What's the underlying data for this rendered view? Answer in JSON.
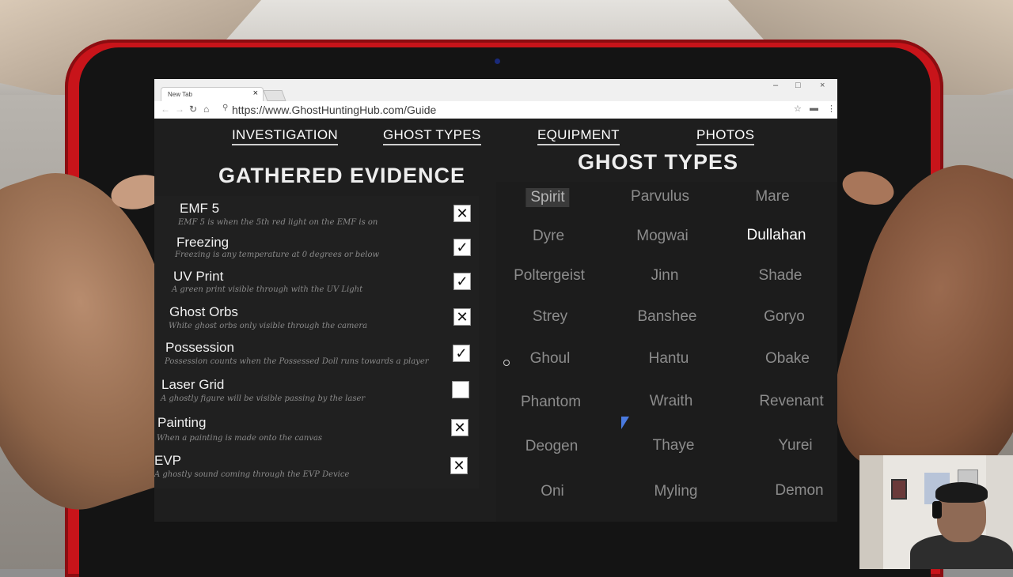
{
  "browser": {
    "tab_title": "New Tab",
    "tab_close": "×",
    "url": "https://www.GhostHuntingHub.com/Guide",
    "window_controls": [
      "–",
      "□",
      "×"
    ]
  },
  "nav_menu": [
    {
      "label": "INVESTIGATION"
    },
    {
      "label": "GHOST TYPES"
    },
    {
      "label": "EQUIPMENT"
    },
    {
      "label": "PHOTOS"
    }
  ],
  "evidence_section": {
    "title": "GATHERED EVIDENCE",
    "items": [
      {
        "name": "EMF 5",
        "description": "EMF 5 is when the 5th red light on the EMF is on",
        "state": "crossed",
        "mark": "✕"
      },
      {
        "name": "Freezing",
        "description": "Freezing is any temperature at 0 degrees or below",
        "state": "checked",
        "mark": "✓"
      },
      {
        "name": "UV Print",
        "description": "A green print visible through with the UV Light",
        "state": "checked",
        "mark": "✓"
      },
      {
        "name": "Ghost Orbs",
        "description": "White ghost orbs only visible through the camera",
        "state": "crossed",
        "mark": "✕"
      },
      {
        "name": "Possession",
        "description": "Possession counts when the Possessed Doll runs towards a player",
        "state": "checked",
        "mark": "✓"
      },
      {
        "name": "Laser Grid",
        "description": "A ghostly figure will be visible passing by the laser",
        "state": "empty",
        "mark": ""
      },
      {
        "name": "Painting",
        "description": "When a painting is made onto the canvas",
        "state": "crossed",
        "mark": "✕"
      },
      {
        "name": "EVP",
        "description": "A ghostly sound coming through the EVP Device",
        "state": "crossed",
        "mark": "✕"
      }
    ]
  },
  "ghost_types_section": {
    "title": "GHOST TYPES",
    "ghosts": [
      "Spirit",
      "Parvulus",
      "Mare",
      "Dyre",
      "Mogwai",
      "Dullahan",
      "Poltergeist",
      "Jinn",
      "Shade",
      "Strey",
      "Banshee",
      "Goryo",
      "Ghoul",
      "Hantu",
      "Obake",
      "Phantom",
      "Wraith",
      "Revenant",
      "Deogen",
      "Thaye",
      "Yurei",
      "Oni",
      "Myling",
      "Demon"
    ],
    "selected": "Spirit",
    "highlighted": "Dullahan"
  },
  "colors": {
    "tablet_frame": "#c8141a",
    "page_background": "#1e1e1e",
    "ghost_text": "#8c8c8c",
    "highlight_text": "#ffffff"
  }
}
